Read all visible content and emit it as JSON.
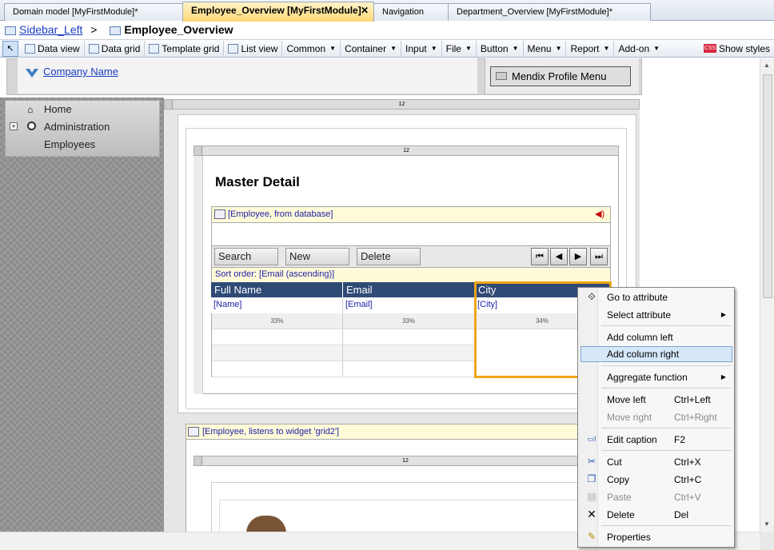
{
  "tabs": [
    {
      "label": "Domain model [MyFirstModule]*"
    },
    {
      "label": "Employee_Overview [MyFirstModule]",
      "active": true
    },
    {
      "label": "Navigation"
    },
    {
      "label": "Department_Overview [MyFirstModule]*"
    }
  ],
  "breadcrumb": {
    "parent": "Sidebar_Left",
    "separator": ">",
    "current": "Employee_Overview"
  },
  "toolbar": {
    "data_view": "Data view",
    "data_grid": "Data grid",
    "template_grid": "Template grid",
    "list_view": "List view",
    "common": "Common",
    "container": "Container",
    "input": "Input",
    "file": "File",
    "button": "Button",
    "menu": "Menu",
    "report": "Report",
    "add_on": "Add-on",
    "show_styles": "Show styles",
    "css_badge": "CSS"
  },
  "header": {
    "company": "Company Name",
    "profile_menu": "Mendix Profile Menu"
  },
  "sidebar": {
    "items": [
      {
        "label": "Home"
      },
      {
        "label": "Administration"
      },
      {
        "label": "Employees"
      }
    ]
  },
  "layout": {
    "column_size": "12"
  },
  "main": {
    "title": "Master Detail",
    "datagrid": {
      "source": "[Employee, from database]",
      "buttons": {
        "search": "Search",
        "new": "New",
        "delete": "Delete"
      },
      "sort_order": "Sort order: [Email (ascending)]",
      "columns": [
        {
          "header": "Full Name",
          "attribute": "[Name]",
          "width": "33%"
        },
        {
          "header": "Email",
          "attribute": "[Email]",
          "width": "33%"
        },
        {
          "header": "City",
          "attribute": "[City]",
          "width": "34%"
        }
      ]
    },
    "listener": "[Employee, listens to widget 'grid2']"
  },
  "context_menu": {
    "items": [
      {
        "label": "Go to attribute",
        "shortcut": ""
      },
      {
        "label": "Select attribute",
        "shortcut": "",
        "submenu": true
      },
      {
        "label": "Add column left",
        "shortcut": ""
      },
      {
        "label": "Add column right",
        "shortcut": "",
        "highlighted": true
      },
      {
        "label": "Aggregate function",
        "shortcut": "",
        "submenu": true
      },
      {
        "label": "Move left",
        "shortcut": "Ctrl+Left"
      },
      {
        "label": "Move right",
        "shortcut": "Ctrl+Right",
        "disabled": true
      },
      {
        "label": "Edit caption",
        "shortcut": "F2"
      },
      {
        "label": "Cut",
        "shortcut": "Ctrl+X"
      },
      {
        "label": "Copy",
        "shortcut": "Ctrl+C"
      },
      {
        "label": "Paste",
        "shortcut": "Ctrl+V",
        "disabled": true
      },
      {
        "label": "Delete",
        "shortcut": "Del"
      },
      {
        "label": "Properties",
        "shortcut": ""
      }
    ]
  },
  "colors": {
    "accent_selection": "#f0a512",
    "grid_header": "#2e4a75",
    "link": "#1a3cc0"
  }
}
